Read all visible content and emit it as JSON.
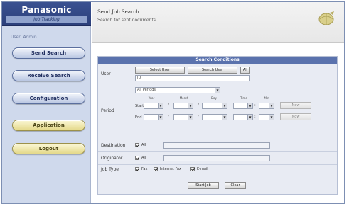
{
  "sidebar": {
    "brand": "Panasonic",
    "subtitle": "Job Tracking",
    "user": "User: Admin",
    "nav": [
      {
        "label": "Send Search"
      },
      {
        "label": "Receive Search"
      },
      {
        "label": "Configuration"
      },
      {
        "label": "Application"
      },
      {
        "label": "Logout"
      }
    ]
  },
  "header": {
    "title": "Send Job Search",
    "subtitle": "Search for sent documents"
  },
  "panel": {
    "title": "Search Conditions",
    "user_row": {
      "label": "User",
      "btn_select": "Select User",
      "btn_search": "Search User",
      "btn_all": "All",
      "value": "ID"
    },
    "period_row": {
      "label": "Period",
      "preset_select": "All Periods",
      "columns": [
        "Year",
        "Month",
        "Day",
        "Time",
        "Min"
      ],
      "start_label": "Start",
      "end_label": "End",
      "start_btn": "Now",
      "end_btn": "Now"
    },
    "destination_row": {
      "label": "Destination",
      "checkbox_label": "All"
    },
    "originator_row": {
      "label": "Originator",
      "checkbox_label": "All"
    },
    "jobtype_row": {
      "label": "Job Type",
      "options": [
        "Fax",
        "Internet Fax",
        "E-mail"
      ]
    },
    "actions": {
      "search": "Start Job",
      "clear": "Clear"
    }
  },
  "colors": {
    "brand_bg": "#2b3f7a",
    "sidebar_bg": "#cfd9ec",
    "panel_title_bg": "#5a72ad",
    "nav_blue": "#b9c6e2",
    "nav_yellow": "#e4d98a"
  },
  "icons": {
    "header_logo": "globe-icon"
  }
}
